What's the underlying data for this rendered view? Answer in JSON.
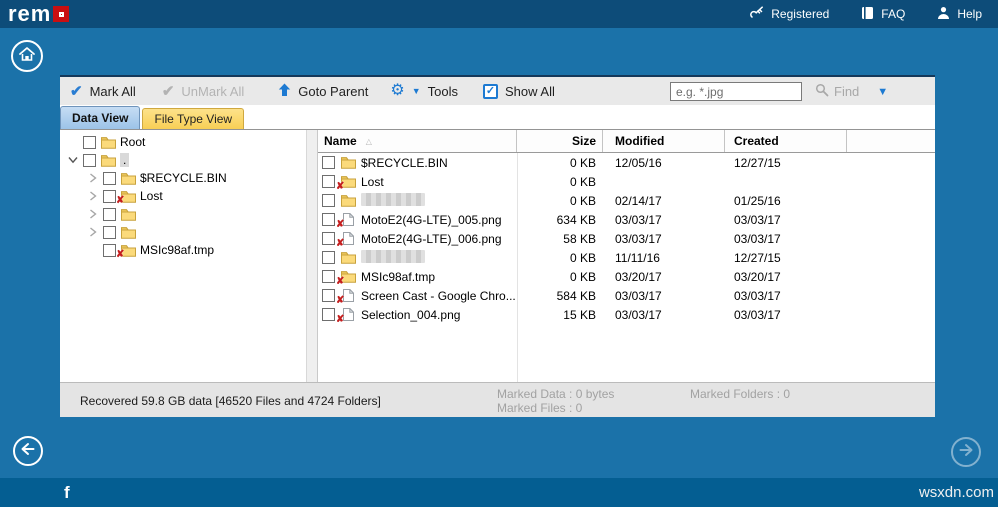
{
  "colors": {
    "topbar": "#0d4c79",
    "background": "#1b72a9",
    "footer": "#045e92",
    "accent_red": "#c90f12",
    "toolbar_blue": "#1d7ad2",
    "active_tab": "#9cc3e8",
    "inactive_tab": "#f8cf55"
  },
  "topbar": {
    "logo_prefix": "rem",
    "links": [
      {
        "icon": "key-icon",
        "label": "Registered"
      },
      {
        "icon": "book-icon",
        "label": "FAQ"
      },
      {
        "icon": "person-icon",
        "label": "Help"
      }
    ]
  },
  "toolbar": {
    "mark_all": "Mark All",
    "unmark_all": "UnMark All",
    "goto_parent": "Goto Parent",
    "tools": "Tools",
    "show_all": "Show All",
    "search_placeholder": "e.g. *.jpg",
    "find_label": "Find"
  },
  "tabs": [
    {
      "label": "Data View",
      "active": true
    },
    {
      "label": "File Type View",
      "active": false
    }
  ],
  "tree": {
    "items": [
      {
        "label": "Root",
        "level": 0,
        "chevron": "none",
        "icon": "folder",
        "blurred": false,
        "selected": false
      },
      {
        "label": ".",
        "level": 0,
        "chevron": "expanded",
        "icon": "folder",
        "blurred": false,
        "selected": true
      },
      {
        "label": "$RECYCLE.BIN",
        "level": 1,
        "chevron": "collapsed",
        "icon": "folder",
        "blurred": false,
        "selected": false
      },
      {
        "label": "Lost",
        "level": 1,
        "chevron": "collapsed",
        "icon": "folder-x",
        "blurred": false,
        "selected": false
      },
      {
        "label": "",
        "level": 1,
        "chevron": "collapsed",
        "icon": "folder",
        "blurred": true,
        "selected": false
      },
      {
        "label": "",
        "level": 1,
        "chevron": "collapsed",
        "icon": "folder",
        "blurred": true,
        "selected": false
      },
      {
        "label": "MSIc98af.tmp",
        "level": 1,
        "chevron": "none",
        "icon": "folder-x",
        "blurred": false,
        "selected": false
      }
    ]
  },
  "table": {
    "columns": [
      "Name",
      "Size",
      "Modified",
      "Created",
      ""
    ],
    "sort_column": "Name",
    "sort_order": "ascending",
    "rows": [
      {
        "name": "$RECYCLE.BIN",
        "icon": "folder",
        "blurred": false,
        "size": "0 KB",
        "modified": "12/05/16",
        "created": "12/27/15"
      },
      {
        "name": "Lost",
        "icon": "folder-x",
        "blurred": false,
        "size": "0 KB",
        "modified": "",
        "created": ""
      },
      {
        "name": "",
        "icon": "folder",
        "blurred": true,
        "size": "0 KB",
        "modified": "02/14/17",
        "created": "01/25/16"
      },
      {
        "name": "MotoE2(4G-LTE)_005.png",
        "icon": "file-x",
        "blurred": false,
        "size": "634 KB",
        "modified": "03/03/17",
        "created": "03/03/17"
      },
      {
        "name": "MotoE2(4G-LTE)_006.png",
        "icon": "file-x",
        "blurred": false,
        "size": "58 KB",
        "modified": "03/03/17",
        "created": "03/03/17"
      },
      {
        "name": "",
        "icon": "folder",
        "blurred": true,
        "size": "0 KB",
        "modified": "11/11/16",
        "created": "12/27/15"
      },
      {
        "name": "MSIc98af.tmp",
        "icon": "folder-x",
        "blurred": false,
        "size": "0 KB",
        "modified": "03/20/17",
        "created": "03/20/17"
      },
      {
        "name": "Screen Cast - Google Chro...",
        "icon": "file-x",
        "blurred": false,
        "size": "584 KB",
        "modified": "03/03/17",
        "created": "03/03/17"
      },
      {
        "name": "Selection_004.png",
        "icon": "file-x",
        "blurred": false,
        "size": "15 KB",
        "modified": "03/03/17",
        "created": "03/03/17"
      }
    ]
  },
  "status": {
    "recovered": "Recovered 59.8 GB data [46520 Files and 4724 Folders]",
    "marked_data": "Marked Data : 0 bytes",
    "marked_files": "Marked Files : 0",
    "marked_folders": "Marked Folders : 0"
  },
  "footer": {
    "facebook_label": "f",
    "watermark": "wsxdn.com"
  }
}
